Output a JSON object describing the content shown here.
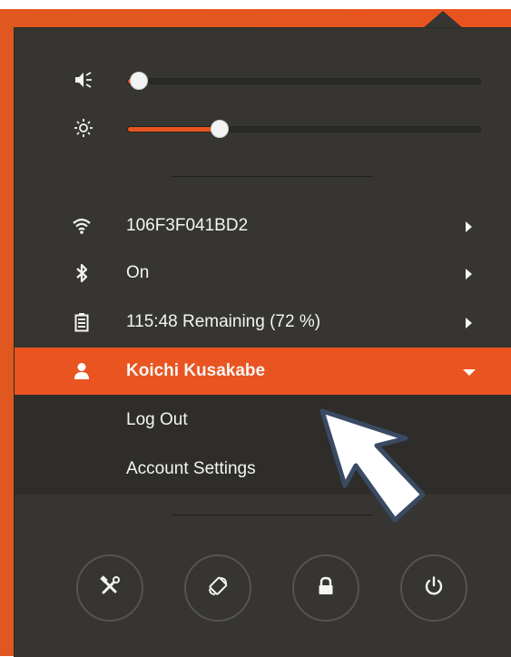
{
  "menu": {
    "volume": {
      "level": 0.03,
      "icon": "speaker-muted-icon"
    },
    "brightness": {
      "level": 0.26,
      "icon": "brightness-icon"
    },
    "wifi": {
      "label": "106F3F041BD2",
      "icon": "wifi-icon"
    },
    "bluetooth": {
      "label": "On",
      "icon": "bluetooth-icon"
    },
    "battery": {
      "label": "115:48 Remaining (72 %)",
      "icon": "battery-icon"
    },
    "user": {
      "label": "Koichi Kusakabe",
      "icon": "person-icon"
    },
    "submenu": {
      "logout_label": "Log Out",
      "account_settings_label": "Account Settings"
    },
    "actions": [
      {
        "name": "settings",
        "icon": "settings-tools-icon"
      },
      {
        "name": "rotation-lock",
        "icon": "rotation-icon"
      },
      {
        "name": "lock",
        "icon": "lock-icon"
      },
      {
        "name": "power",
        "icon": "power-icon"
      }
    ]
  },
  "colors": {
    "accent": "#e95420",
    "menu_bg": "#363531",
    "text": "#f4f4f2"
  }
}
